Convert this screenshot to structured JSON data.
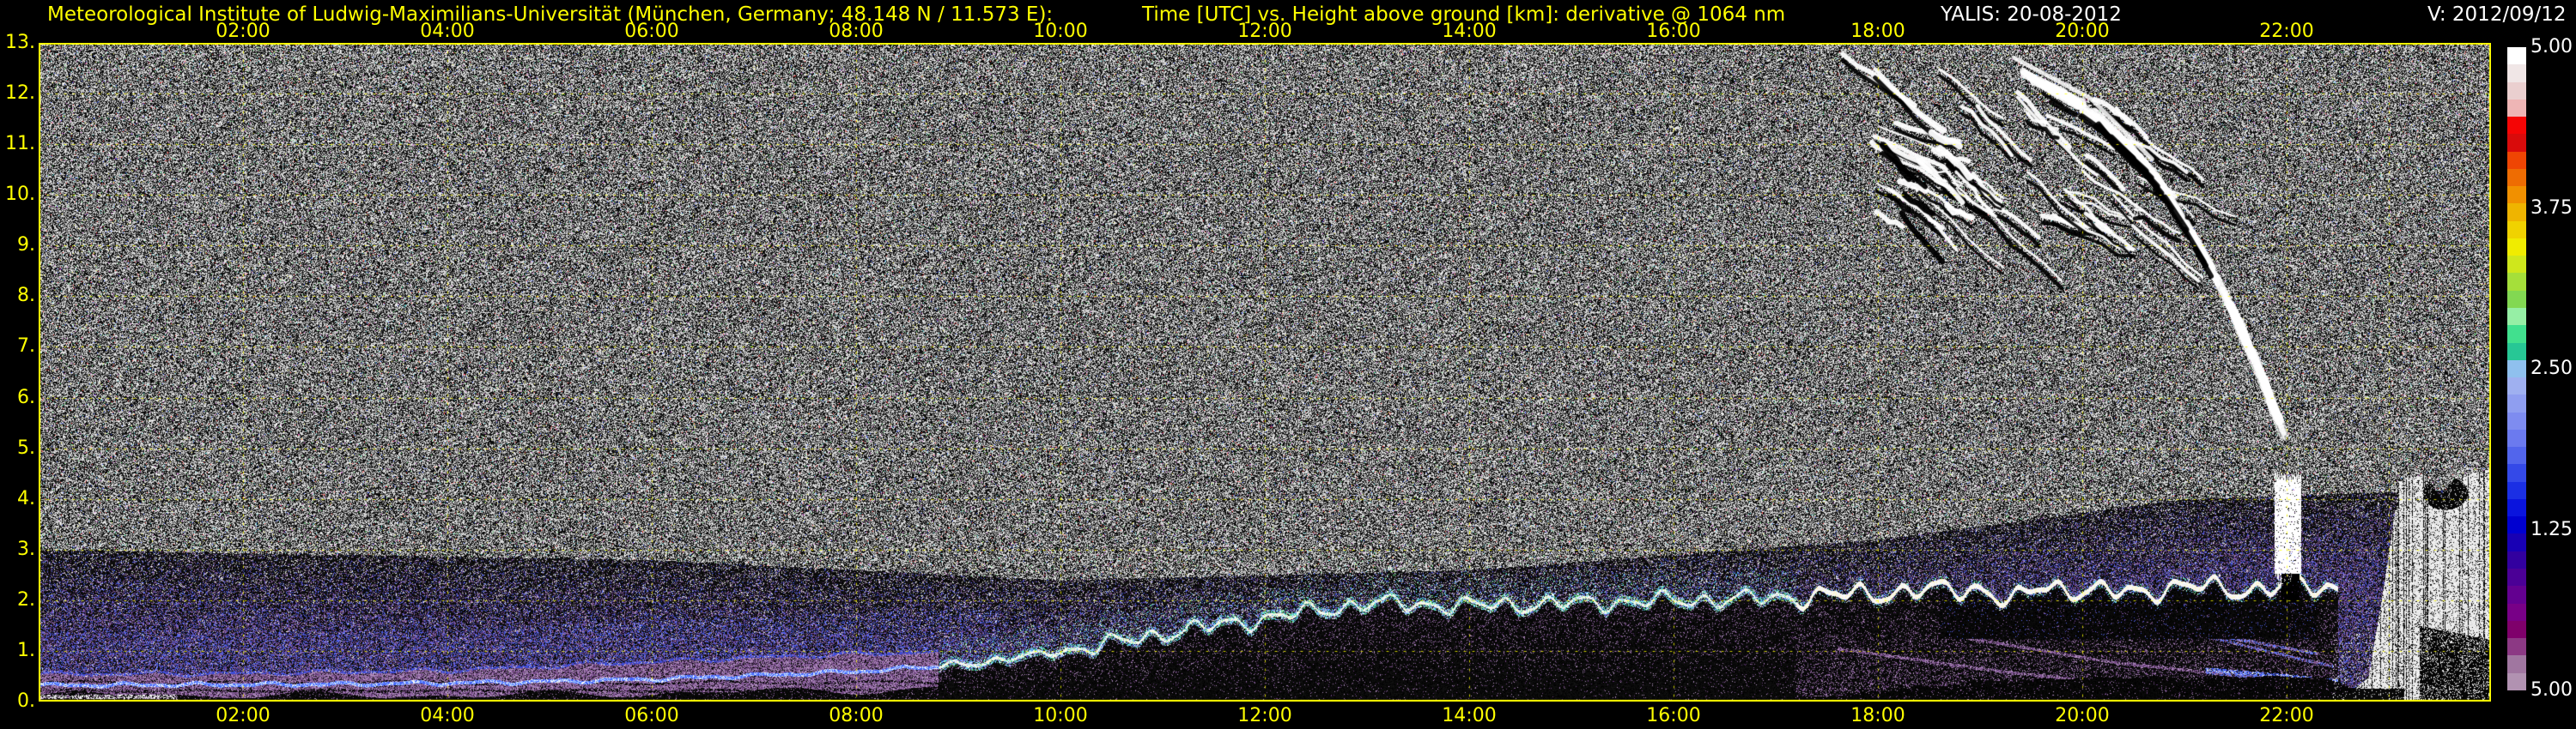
{
  "header": {
    "institute": "Meteorological Institute of Ludwig-Maximilians-Universität (München, Germany; 48.148 N / 11.573 E):",
    "plot_title": "Time [UTC] vs. Height above ground [km]: derivative @ 1064 nm",
    "instrument_date": "YALIS: 20-08-2012",
    "version": "V: 2012/09/12"
  },
  "colors": {
    "background": "#000000",
    "axis_text": "#ffff00",
    "secondary_text": "#ffffff",
    "grid": "#ffff00",
    "border": "#ffff00"
  },
  "chart_data": {
    "type": "heatmap",
    "title": "Time [UTC] vs. Height above ground [km]: derivative @ 1064 nm",
    "xlabel": "Time [UTC]",
    "ylabel": "Height above ground [km]",
    "x_axis": {
      "range_hours": [
        0,
        24
      ],
      "ticks": [
        {
          "hour": 2,
          "label": "02:00"
        },
        {
          "hour": 4,
          "label": "04:00"
        },
        {
          "hour": 6,
          "label": "06:00"
        },
        {
          "hour": 8,
          "label": "08:00"
        },
        {
          "hour": 10,
          "label": "10:00"
        },
        {
          "hour": 12,
          "label": "12:00"
        },
        {
          "hour": 14,
          "label": "14:00"
        },
        {
          "hour": 16,
          "label": "16:00"
        },
        {
          "hour": 18,
          "label": "18:00"
        },
        {
          "hour": 20,
          "label": "20:00"
        },
        {
          "hour": 22,
          "label": "22:00"
        }
      ]
    },
    "y_axis": {
      "range_km": [
        0,
        13
      ],
      "ticks": [
        {
          "km": 13,
          "label": "13."
        },
        {
          "km": 12,
          "label": "12."
        },
        {
          "km": 11,
          "label": "11."
        },
        {
          "km": 10,
          "label": "10."
        },
        {
          "km": 9,
          "label": "9."
        },
        {
          "km": 8,
          "label": "8."
        },
        {
          "km": 7,
          "label": "7."
        },
        {
          "km": 6,
          "label": "6."
        },
        {
          "km": 5,
          "label": "5."
        },
        {
          "km": 4,
          "label": "4."
        },
        {
          "km": 3,
          "label": "3."
        },
        {
          "km": 2,
          "label": "2."
        },
        {
          "km": 1,
          "label": "1."
        },
        {
          "km": 0,
          "label": "0."
        }
      ]
    },
    "grid": {
      "show": true,
      "vertical_hours": [
        2,
        4,
        6,
        8,
        10,
        12,
        14,
        16,
        18,
        20,
        22,
        23
      ],
      "horizontal_km": [
        1,
        2,
        3,
        4,
        5,
        6,
        7,
        8,
        9,
        10,
        11,
        12
      ]
    },
    "colorbar": {
      "labels": [
        {
          "pos": 0.0,
          "text": "5.00"
        },
        {
          "pos": 0.25,
          "text": "3.75"
        },
        {
          "pos": 0.5,
          "text": "2.50"
        },
        {
          "pos": 0.75,
          "text": "1.25"
        },
        {
          "pos": 1.0,
          "text": "5.00"
        }
      ],
      "colors": [
        "#ffffff",
        "#f0e6e6",
        "#eacfcf",
        "#eeb5b5",
        "#f50505",
        "#d90b0b",
        "#ef4503",
        "#ee6c02",
        "#f19000",
        "#efb400",
        "#f0d200",
        "#f0ec00",
        "#cfe71c",
        "#a5df3a",
        "#82d852",
        "#96efa5",
        "#41e08e",
        "#27c795",
        "#8fc0ee",
        "#9fb0f0",
        "#8f9ef0",
        "#7e8cf0",
        "#6b7aef",
        "#5265ec",
        "#3449e8",
        "#1b2fe4",
        "#0a14dd",
        "#0000d0",
        "#1800b4",
        "#32009f",
        "#4b0096",
        "#630090",
        "#780087",
        "#7f006b",
        "#8c3984",
        "#a076a0",
        "#b192b1"
      ]
    },
    "features": {
      "purple_zone_top_km": [
        [
          0,
          3.0
        ],
        [
          6,
          2.8
        ],
        [
          10,
          2.4
        ],
        [
          14,
          2.6
        ],
        [
          18,
          3.2
        ],
        [
          21,
          4.0
        ],
        [
          24,
          4.2
        ]
      ],
      "boundary_layer_line_km": [
        [
          0,
          0.33
        ],
        [
          3,
          0.35
        ],
        [
          5,
          0.4
        ],
        [
          6,
          0.45
        ],
        [
          7,
          0.52
        ],
        [
          8,
          0.6
        ],
        [
          8.8,
          0.7
        ],
        [
          9.5,
          0.85
        ],
        [
          10,
          1.0
        ],
        [
          10.5,
          1.15
        ],
        [
          11,
          1.35
        ],
        [
          11.5,
          1.5
        ],
        [
          12,
          1.65
        ],
        [
          12.5,
          1.8
        ],
        [
          13,
          1.95
        ],
        [
          14,
          1.9
        ],
        [
          15,
          1.95
        ],
        [
          16,
          2.0
        ],
        [
          17,
          2.05
        ],
        [
          18,
          2.15
        ],
        [
          19,
          2.25
        ],
        [
          19.3,
          1.95
        ],
        [
          19.6,
          2.3
        ],
        [
          20,
          2.2
        ],
        [
          20.5,
          2.15
        ],
        [
          21,
          2.3
        ],
        [
          21.5,
          2.2
        ],
        [
          22,
          2.3
        ],
        [
          22.4,
          2.25
        ]
      ],
      "night_band": {
        "t_end": 8.8,
        "top_km": [
          [
            0,
            0.55
          ],
          [
            2,
            0.57
          ],
          [
            4,
            0.63
          ],
          [
            6,
            0.8
          ],
          [
            7,
            0.88
          ],
          [
            8,
            0.95
          ],
          [
            8.8,
            1.0
          ]
        ],
        "bottom_km": 0.13
      },
      "evening": {
        "pocket": {
          "t0": 18.6,
          "t1": 22.3,
          "bottom_km": 1.25
        },
        "ground_black_top_km": [
          [
            0,
            0.06
          ],
          [
            17,
            0.06
          ],
          [
            17.5,
            0.12
          ],
          [
            19,
            0.4
          ],
          [
            20,
            0.48
          ],
          [
            22.3,
            0.5
          ],
          [
            22.6,
            0.3
          ],
          [
            23.2,
            0.25
          ],
          [
            24,
            0.1
          ]
        ],
        "streaks": [
          [
            [
              17.6,
              1.05
            ],
            [
              19.2,
              0.6
            ],
            [
              20.5,
              0.32
            ],
            [
              21.8,
              0.2
            ]
          ],
          [
            [
              18.6,
              1.35
            ],
            [
              20.3,
              0.78
            ],
            [
              21.5,
              0.52
            ],
            [
              22.3,
              0.42
            ]
          ],
          [
            [
              19.9,
              1.9
            ],
            [
              21.2,
              1.35
            ],
            [
              22.3,
              0.95
            ]
          ],
          [
            [
              20.6,
              1.6
            ],
            [
              21.7,
              1.05
            ],
            [
              22.45,
              0.7
            ]
          ]
        ],
        "blue_line": [
          [
            21.3,
            0.62
          ],
          [
            22.0,
            0.5
          ],
          [
            22.6,
            0.38
          ]
        ]
      },
      "cirrus": {
        "field": {
          "t0": 17.6,
          "t1": 20.9,
          "h_top": 12.8,
          "h_bottom": 9.2,
          "count": 46
        },
        "blob": {
          "t": 18.35,
          "h": 10.4,
          "rt": 0.42,
          "rh": 0.9
        },
        "band": [
          [
            19.35,
            12.45
          ],
          [
            20.1,
            11.65
          ],
          [
            20.7,
            10.45
          ],
          [
            21.15,
            9.0
          ],
          [
            21.5,
            7.6
          ],
          [
            21.8,
            6.2
          ],
          [
            21.97,
            5.3
          ]
        ],
        "small_blob": {
          "t0": 21.88,
          "t1": 22.14,
          "h0": 2.55,
          "h1": 4.55
        },
        "small_blob_shadow": {
          "t0": 21.95,
          "t1": 22.12,
          "h0": 1.98,
          "h1": 2.52
        }
      },
      "rain": {
        "t_start": 22.55,
        "top_km": [
          [
            22.55,
            0.05
          ],
          [
            22.8,
            0.5
          ],
          [
            22.95,
            2.3
          ],
          [
            23.1,
            4.35
          ],
          [
            23.35,
            4.5
          ],
          [
            23.5,
            4.05
          ],
          [
            23.65,
            4.45
          ],
          [
            24,
            4.6
          ]
        ]
      },
      "noise": {
        "colored_fraction": 0.027,
        "white_fraction": 0.5
      }
    }
  }
}
